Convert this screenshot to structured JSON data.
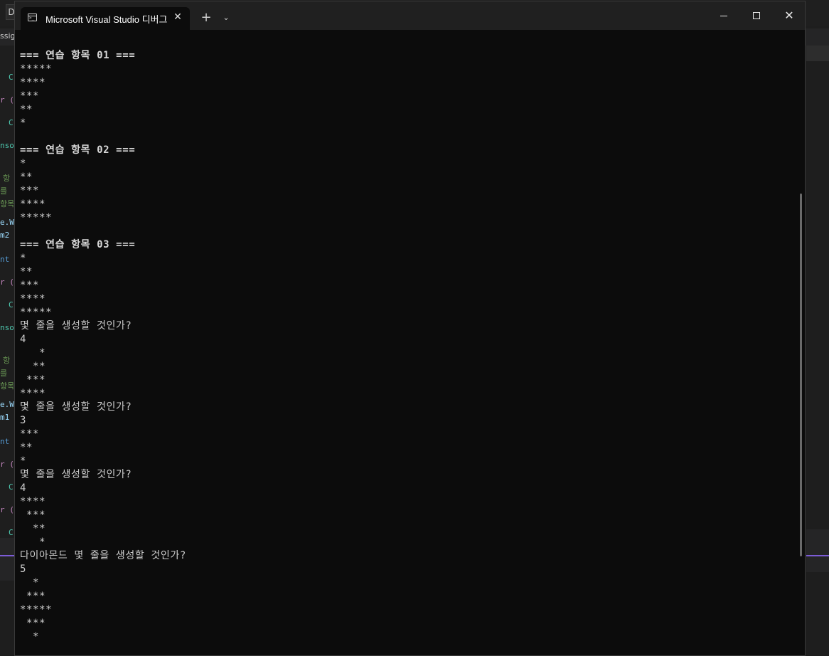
{
  "window": {
    "tab_title": "Microsoft Visual Studio 디버그",
    "tab_close": "✕",
    "new_tab": "+",
    "dropdown": "⌄",
    "close_glyph": "✕"
  },
  "background_ide": {
    "top_letter": "D",
    "tab_fragment": "ssig",
    "code_fragments": [
      "C",
      "r (",
      "C",
      "nso",
      "항",
      "를",
      "항목",
      "e.W",
      "m2",
      "nt",
      "r (",
      "C",
      "nso",
      "항",
      "를",
      "항목",
      "e.W",
      "m1",
      "nt",
      "r (",
      "C",
      "r (",
      "C"
    ]
  },
  "console": {
    "lines": [
      {
        "text": "=== 연습 항목 01 ===",
        "kind": "heading"
      },
      {
        "text": "*****",
        "kind": "out"
      },
      {
        "text": "****",
        "kind": "out"
      },
      {
        "text": "***",
        "kind": "out"
      },
      {
        "text": "**",
        "kind": "out"
      },
      {
        "text": "*",
        "kind": "out"
      },
      {
        "text": "",
        "kind": "out"
      },
      {
        "text": "=== 연습 항목 02 ===",
        "kind": "heading"
      },
      {
        "text": "*",
        "kind": "out"
      },
      {
        "text": "**",
        "kind": "out"
      },
      {
        "text": "***",
        "kind": "out"
      },
      {
        "text": "****",
        "kind": "out"
      },
      {
        "text": "*****",
        "kind": "out"
      },
      {
        "text": "",
        "kind": "out"
      },
      {
        "text": "=== 연습 항목 03 ===",
        "kind": "heading"
      },
      {
        "text": "*",
        "kind": "out"
      },
      {
        "text": "**",
        "kind": "out"
      },
      {
        "text": "***",
        "kind": "out"
      },
      {
        "text": "****",
        "kind": "out"
      },
      {
        "text": "*****",
        "kind": "out"
      },
      {
        "text": "몇 줄을 생성할 것인가?",
        "kind": "prompt"
      },
      {
        "text": "4",
        "kind": "input"
      },
      {
        "text": "   *",
        "kind": "out"
      },
      {
        "text": "  **",
        "kind": "out"
      },
      {
        "text": " ***",
        "kind": "out"
      },
      {
        "text": "****",
        "kind": "out"
      },
      {
        "text": "몇 줄을 생성할 것인가?",
        "kind": "prompt"
      },
      {
        "text": "3",
        "kind": "input"
      },
      {
        "text": "***",
        "kind": "out"
      },
      {
        "text": "**",
        "kind": "out"
      },
      {
        "text": "*",
        "kind": "out"
      },
      {
        "text": "몇 줄을 생성할 것인가?",
        "kind": "prompt"
      },
      {
        "text": "4",
        "kind": "input"
      },
      {
        "text": "****",
        "kind": "out"
      },
      {
        "text": " ***",
        "kind": "out"
      },
      {
        "text": "  **",
        "kind": "out"
      },
      {
        "text": "   *",
        "kind": "out"
      },
      {
        "text": "다이아몬드 몇 줄을 생성할 것인가?",
        "kind": "prompt"
      },
      {
        "text": "5",
        "kind": "input"
      },
      {
        "text": "  *",
        "kind": "out"
      },
      {
        "text": " ***",
        "kind": "out"
      },
      {
        "text": "*****",
        "kind": "out"
      },
      {
        "text": " ***",
        "kind": "out"
      },
      {
        "text": "  *",
        "kind": "out"
      }
    ]
  },
  "colors": {
    "console_bg": "#0c0c0c",
    "console_text": "#cccccc",
    "titlebar_bg": "#202020"
  }
}
